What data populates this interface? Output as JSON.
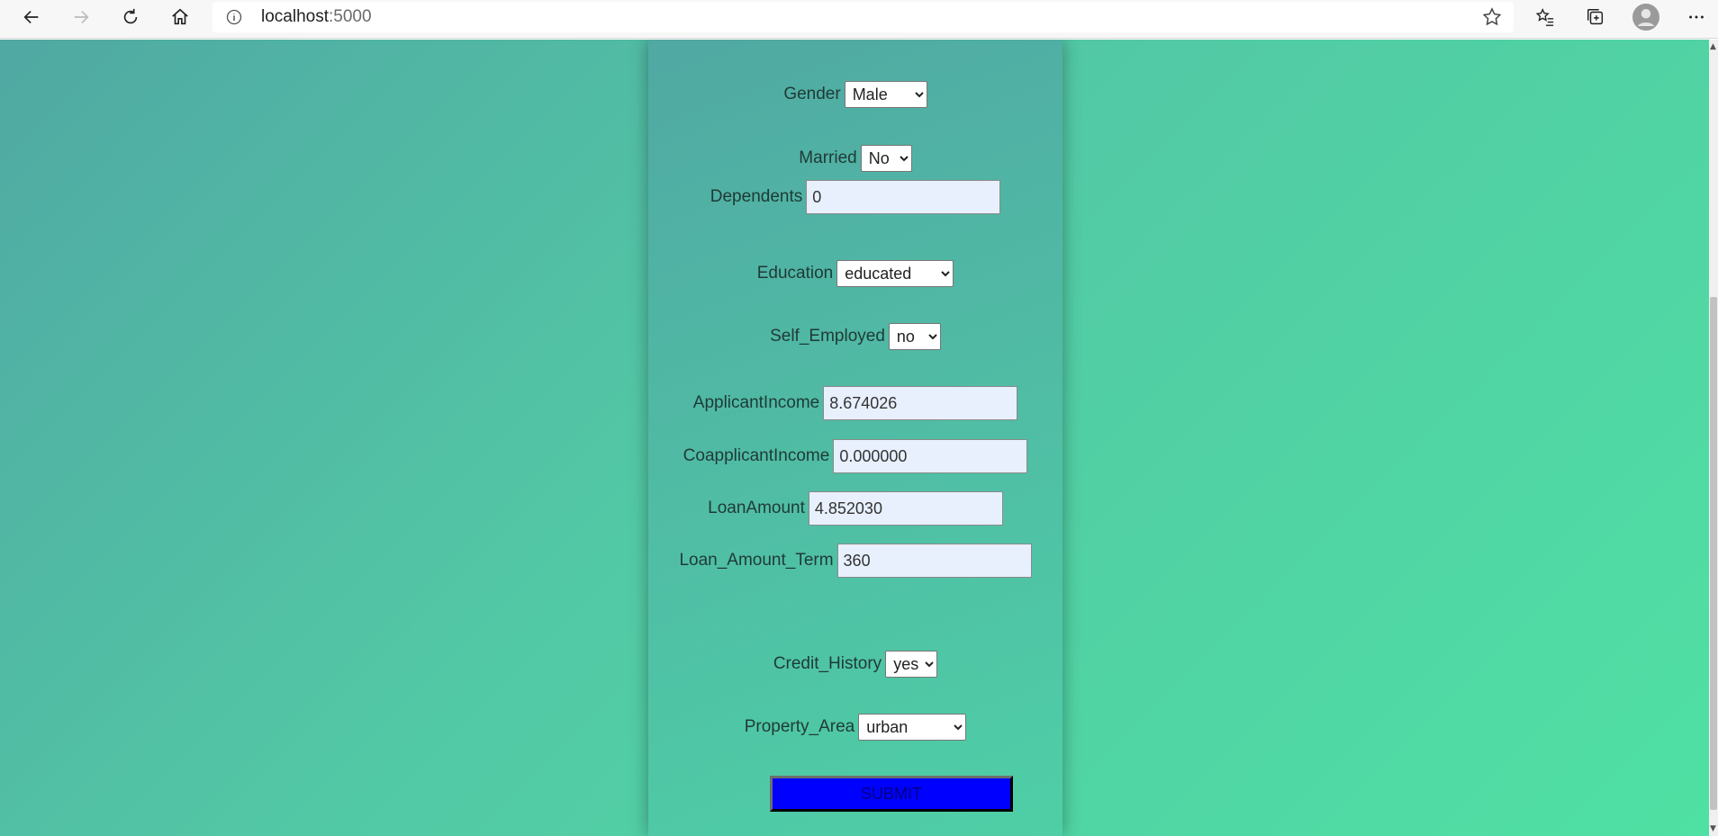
{
  "browser": {
    "url_host": "localhost",
    "url_port": ":5000"
  },
  "form": {
    "gender": {
      "label": "Gender",
      "value": "Male"
    },
    "married": {
      "label": "Married",
      "value": "No"
    },
    "dependents": {
      "label": "Dependents",
      "value": "0"
    },
    "education": {
      "label": "Education",
      "value": "educated"
    },
    "self_employed": {
      "label": "Self_Employed",
      "value": "no"
    },
    "applicant_income": {
      "label": "ApplicantIncome",
      "value": "8.674026"
    },
    "coapplicant_income": {
      "label": "CoapplicantIncome",
      "value": "0.000000"
    },
    "loan_amount": {
      "label": "LoanAmount",
      "value": "4.852030"
    },
    "loan_amount_term": {
      "label": "Loan_Amount_Term",
      "value": "360"
    },
    "credit_history": {
      "label": "Credit_History",
      "value": "yes"
    },
    "property_area": {
      "label": "Property_Area",
      "value": "urban"
    },
    "submit_label": "SUBMIT"
  },
  "colors": {
    "bg_start": "#50a9a3",
    "bg_end": "#4fe0a3",
    "submit_bg": "#0000ff",
    "input_bg": "#e8f0fe"
  }
}
